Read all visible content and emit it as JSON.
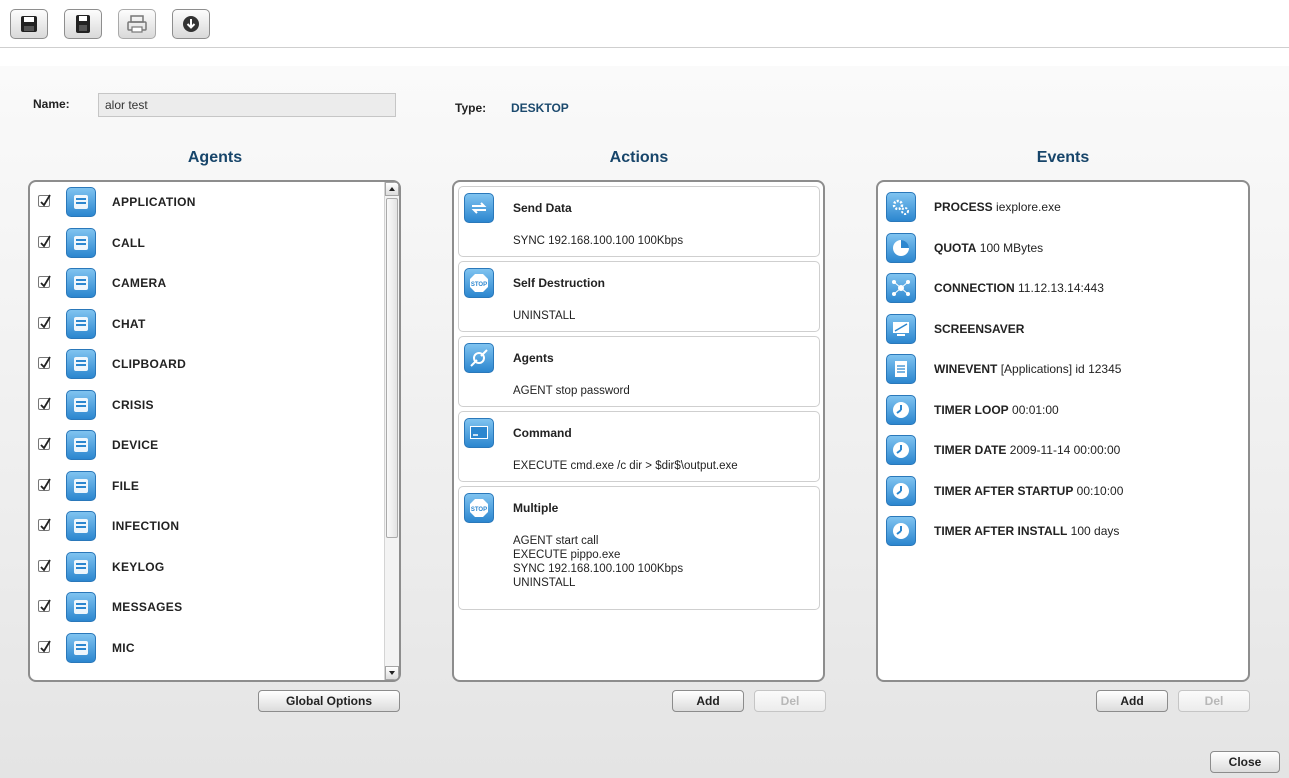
{
  "toolbar": {
    "buttons": [
      {
        "icon": "save-icon"
      },
      {
        "icon": "save-as-icon"
      },
      {
        "icon": "print-icon"
      },
      {
        "icon": "download-icon"
      }
    ]
  },
  "header": {
    "name_label": "Name:",
    "name_value": "alor test",
    "type_label": "Type:",
    "type_value": "DESKTOP"
  },
  "agents": {
    "title": "Agents",
    "items": [
      {
        "label": "APPLICATION",
        "checked": true,
        "icon": "application-icon"
      },
      {
        "label": "CALL",
        "checked": true,
        "icon": "call-icon"
      },
      {
        "label": "CAMERA",
        "checked": true,
        "icon": "camera-icon"
      },
      {
        "label": "CHAT",
        "checked": true,
        "icon": "chat-icon"
      },
      {
        "label": "CLIPBOARD",
        "checked": true,
        "icon": "clipboard-icon"
      },
      {
        "label": "CRISIS",
        "checked": true,
        "icon": "crisis-icon"
      },
      {
        "label": "DEVICE",
        "checked": true,
        "icon": "device-icon"
      },
      {
        "label": "FILE",
        "checked": true,
        "icon": "file-icon"
      },
      {
        "label": "INFECTION",
        "checked": true,
        "icon": "infection-icon"
      },
      {
        "label": "KEYLOG",
        "checked": true,
        "icon": "keylog-icon"
      },
      {
        "label": "MESSAGES",
        "checked": true,
        "icon": "messages-icon"
      },
      {
        "label": "MIC",
        "checked": true,
        "icon": "mic-icon"
      }
    ],
    "global_options_label": "Global Options"
  },
  "actions": {
    "title": "Actions",
    "items": [
      {
        "title": "Send Data",
        "icon": "send-data-icon",
        "lines": [
          "SYNC 192.168.100.100 100Kbps"
        ]
      },
      {
        "title": "Self Destruction",
        "icon": "stop-icon",
        "lines": [
          "UNINSTALL"
        ]
      },
      {
        "title": "Agents",
        "icon": "agents-icon",
        "lines": [
          "AGENT stop password"
        ]
      },
      {
        "title": "Command",
        "icon": "command-icon",
        "lines": [
          "EXECUTE cmd.exe /c dir > $dir$\\output.exe"
        ]
      },
      {
        "title": "Multiple",
        "icon": "stop-icon",
        "lines": [
          "AGENT start call",
          "EXECUTE pippo.exe",
          "SYNC 192.168.100.100 100Kbps",
          "UNINSTALL"
        ]
      }
    ],
    "add_label": "Add",
    "del_label": "Del"
  },
  "events": {
    "title": "Events",
    "items": [
      {
        "name": "PROCESS",
        "detail": "iexplore.exe",
        "icon": "process-icon"
      },
      {
        "name": "QUOTA",
        "detail": "100 MBytes",
        "icon": "quota-icon"
      },
      {
        "name": "CONNECTION",
        "detail": "11.12.13.14:443",
        "icon": "connection-icon"
      },
      {
        "name": "SCREENSAVER",
        "detail": "",
        "icon": "screensaver-icon"
      },
      {
        "name": "WINEVENT",
        "detail": "[Applications] id 12345",
        "icon": "winevent-icon"
      },
      {
        "name": "TIMER LOOP",
        "detail": "00:01:00",
        "icon": "clock-icon"
      },
      {
        "name": "TIMER DATE",
        "detail": "2009-11-14 00:00:00",
        "icon": "clock-icon"
      },
      {
        "name": "TIMER AFTER STARTUP",
        "detail": "00:10:00",
        "icon": "clock-icon"
      },
      {
        "name": "TIMER AFTER INSTALL",
        "detail": "100 days",
        "icon": "clock-icon"
      }
    ],
    "add_label": "Add",
    "del_label": "Del"
  },
  "footer": {
    "close_label": "Close"
  }
}
